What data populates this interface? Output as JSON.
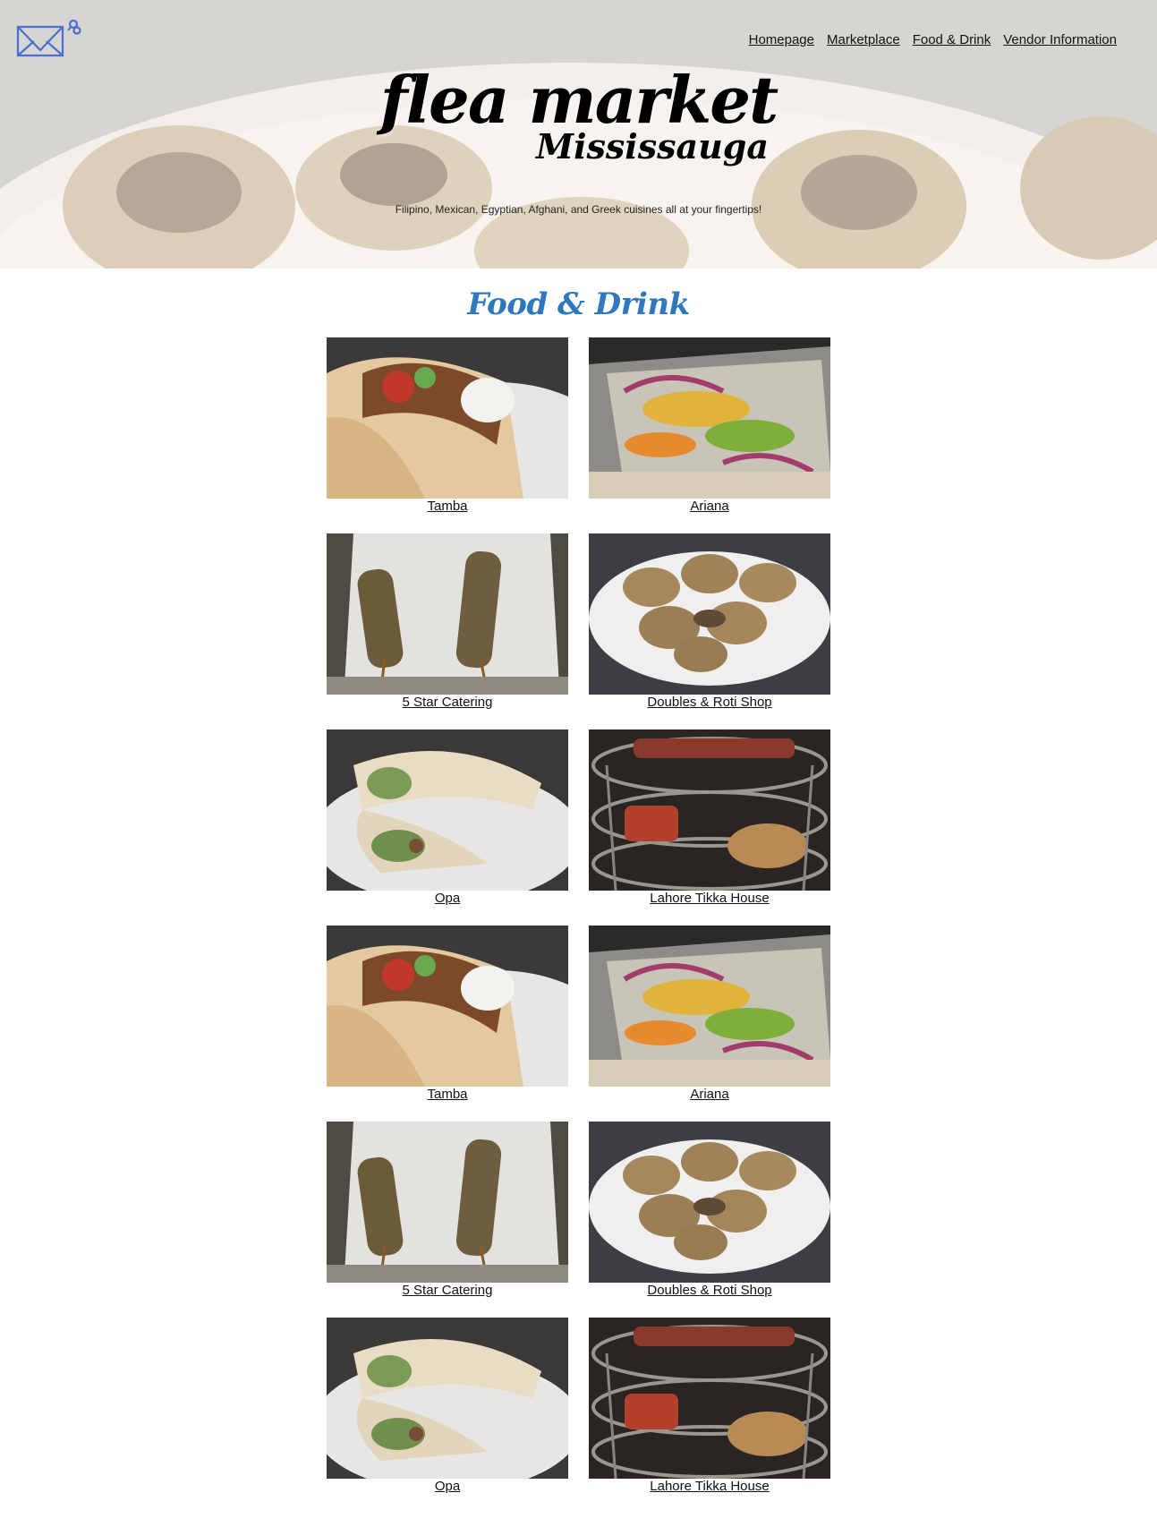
{
  "nav": {
    "items": [
      {
        "label": "Homepage"
      },
      {
        "label": "Marketplace"
      },
      {
        "label": "Food & Drink"
      },
      {
        "label": "Vendor Information"
      }
    ]
  },
  "hero": {
    "brand_main": "flea market",
    "brand_sub": "Mississauga",
    "tagline": "Filipino, Mexican, Egyptian, Afghani, and Greek cuisines all at your fingertips!"
  },
  "section": {
    "title": "Food & Drink"
  },
  "colors": {
    "accent": "#2f78c0",
    "logo": "#4a6fd0"
  },
  "vendors": [
    {
      "name": "Tamba",
      "photo": "gyro-wrap"
    },
    {
      "name": "Ariana",
      "photo": "pepper-tray"
    },
    {
      "name": "5 Star Catering",
      "photo": "kebab-skewers"
    },
    {
      "name": "Doubles & Roti Shop",
      "photo": "pani-puri-plate"
    },
    {
      "name": "Opa",
      "photo": "shawarma-wrap"
    },
    {
      "name": "Lahore Tikka House",
      "photo": "tikka-grill"
    },
    {
      "name": "Tamba",
      "photo": "gyro-wrap"
    },
    {
      "name": "Ariana",
      "photo": "pepper-tray"
    },
    {
      "name": "5 Star Catering",
      "photo": "kebab-skewers"
    },
    {
      "name": "Doubles & Roti Shop",
      "photo": "pani-puri-plate"
    },
    {
      "name": "Opa",
      "photo": "shawarma-wrap"
    },
    {
      "name": "Lahore Tikka House",
      "photo": "tikka-grill"
    }
  ]
}
